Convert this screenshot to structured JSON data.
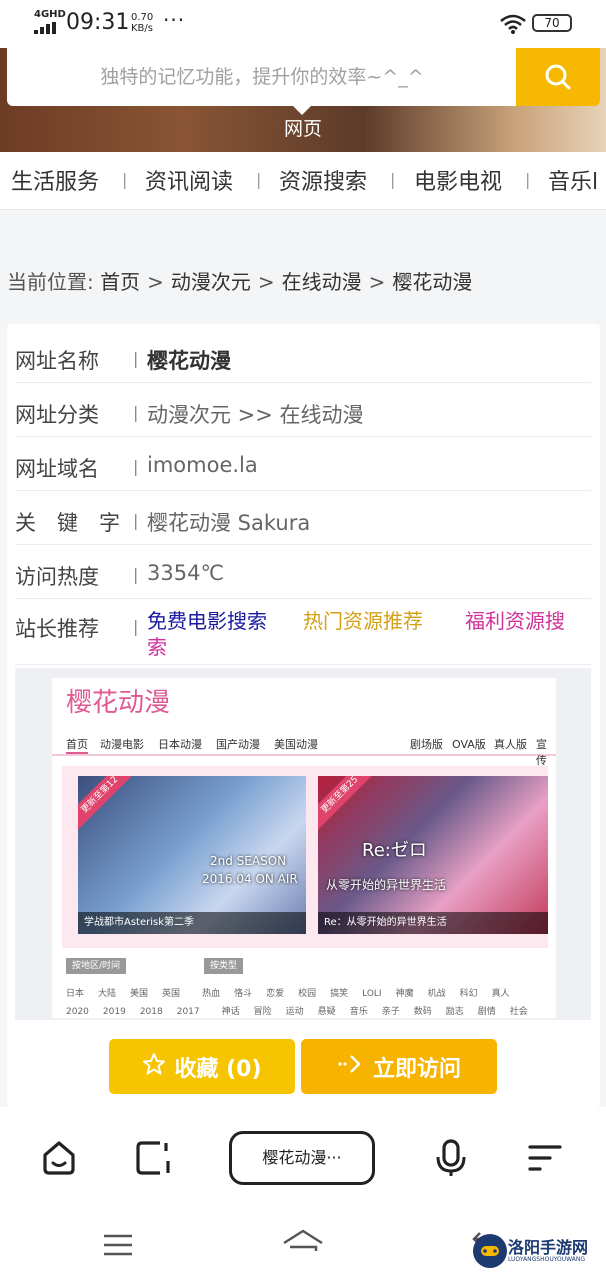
{
  "status_bar": {
    "network": "4GHD",
    "time": "09:31",
    "speed_value": "0.70",
    "speed_unit": "KB/s",
    "more": "···",
    "battery": "70"
  },
  "search": {
    "placeholder": "独特的记忆功能，提升你的效率~^_^",
    "active_tab": "网页"
  },
  "categories": [
    "生活服务",
    "资讯阅读",
    "资源搜索",
    "电影电视",
    "音乐l"
  ],
  "breadcrumb": {
    "prefix": "当前位置:",
    "items": [
      "首页",
      "动漫次元",
      "在线动漫",
      "樱花动漫"
    ]
  },
  "info": {
    "rows": [
      {
        "label": "网址名称",
        "value": "樱花动漫"
      },
      {
        "label": "网址分类",
        "value": "动漫次元 >> 在线动漫"
      },
      {
        "label": "网址域名",
        "value": "imomoe.la"
      },
      {
        "label": "关　键　字",
        "value": "樱花动漫 Sakura"
      },
      {
        "label": "访问热度",
        "value": "3354℃"
      }
    ],
    "recommend_label": "站长推荐",
    "recommend": [
      {
        "text": "免费电影搜索",
        "color": "#1a1aa0"
      },
      {
        "text": "热门资源推荐",
        "color": "#d4a017"
      },
      {
        "text": "福利资源搜",
        "color": "#d0319a"
      },
      {
        "text": "索",
        "color": "#d0319a"
      }
    ]
  },
  "preview": {
    "title": "樱花动漫",
    "nav_left": [
      "首页",
      "动漫电影",
      "日本动漫",
      "国产动漫",
      "美国动漫"
    ],
    "nav_right": [
      "剧场版",
      "OVA版",
      "真人版",
      "宣传"
    ],
    "slide1": {
      "badge": "更新至第12",
      "overlay_a": "2nd SEASON",
      "overlay_b": "2016.04 ON AIR",
      "caption": "学战都市Asterisk第二季"
    },
    "slide2": {
      "badge": "更新至第25",
      "overlay_a": "Re:ゼロ",
      "overlay_b": "从零开始的异世界生活",
      "caption": "Re：从零开始的异世界生活"
    },
    "tag_region": "按地区/时间",
    "tag_type": "按类型",
    "grid_row1": [
      "日本",
      "大陆",
      "美国",
      "英国",
      "热血",
      "恪斗",
      "恋爱",
      "校园",
      "搞笑",
      "LOLI",
      "神魔",
      "机战",
      "科幻",
      "真人"
    ],
    "grid_row2": [
      "2020",
      "2019",
      "2018",
      "2017",
      "神话",
      "冒险",
      "运动",
      "悬疑",
      "音乐",
      "亲子",
      "数码",
      "励志",
      "剧情",
      "社会"
    ]
  },
  "actions": {
    "favorite": "收藏 (0)",
    "visit": "立即访问"
  },
  "toolbar": {
    "center_label": "樱花动漫···"
  },
  "watermark": {
    "text": "洛阳手游网",
    "sub": "LUOYANGSHOUYOUWANG"
  }
}
